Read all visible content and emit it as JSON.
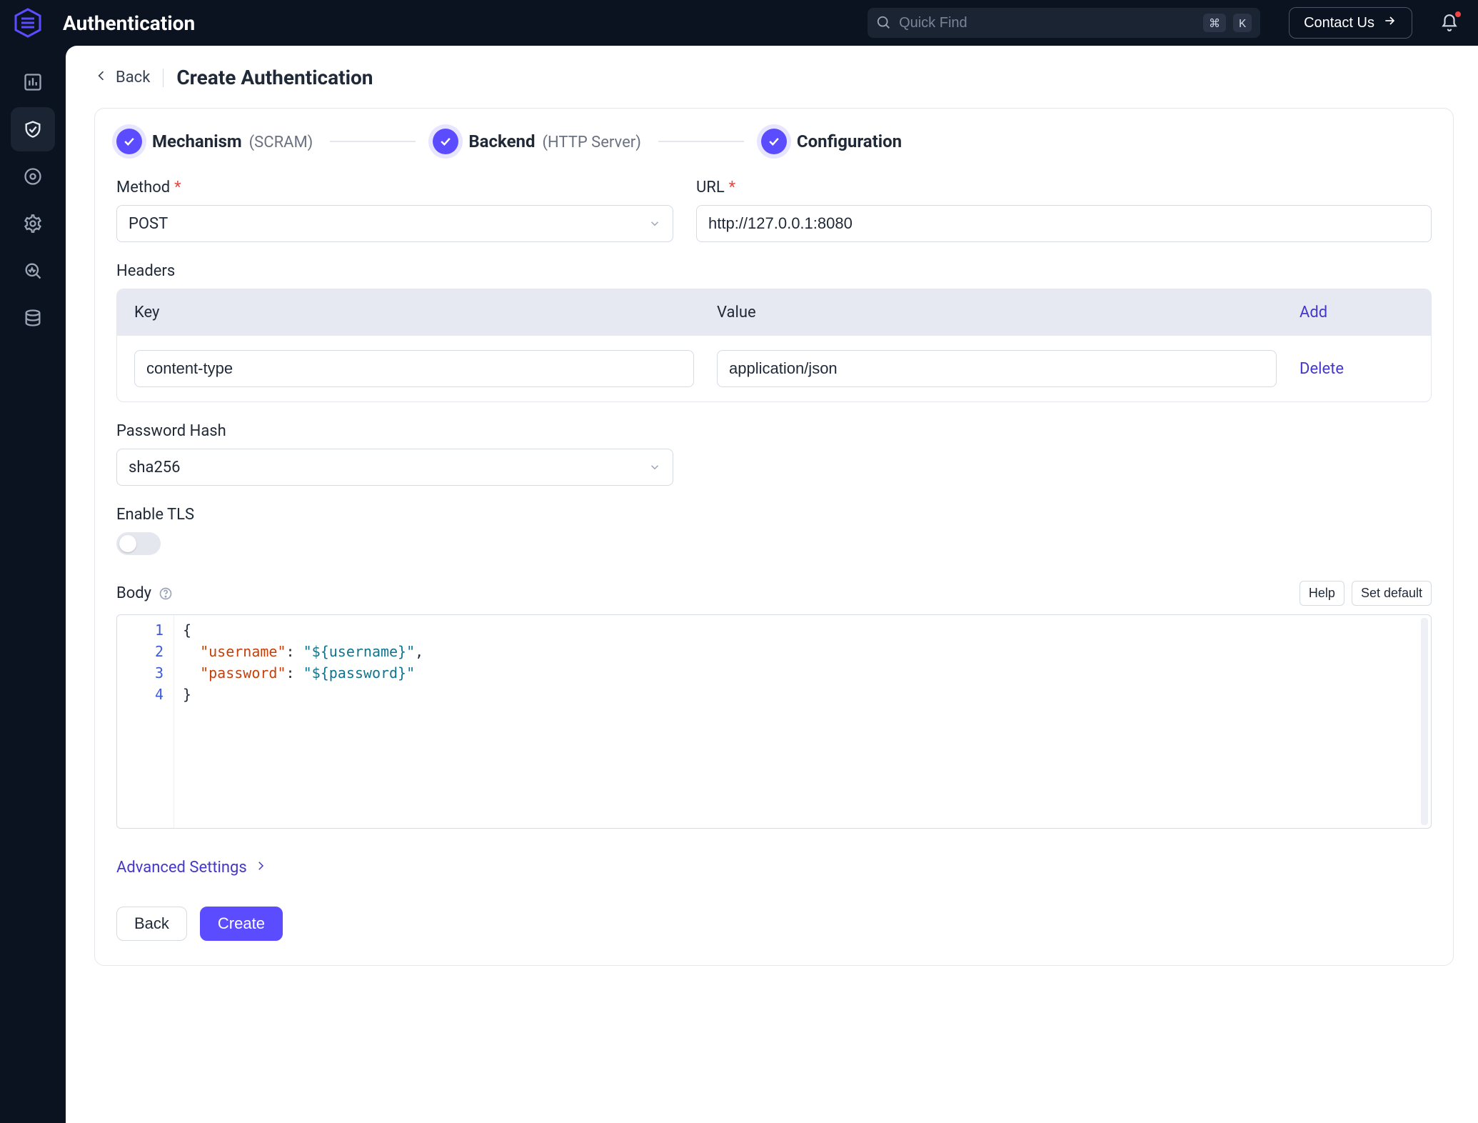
{
  "header": {
    "title": "Authentication",
    "search_placeholder": "Quick Find",
    "kbd_cmd": "⌘",
    "kbd_k": "K",
    "contact_label": "Contact Us"
  },
  "breadcrumb": {
    "back_label": "Back",
    "page_title": "Create Authentication"
  },
  "stepper": {
    "step1_label": "Mechanism",
    "step1_sub": "(SCRAM)",
    "step2_label": "Backend",
    "step2_sub": "(HTTP Server)",
    "step3_label": "Configuration"
  },
  "form": {
    "method_label": "Method",
    "method_value": "POST",
    "url_label": "URL",
    "url_value": "http://127.0.0.1:8080",
    "headers_label": "Headers",
    "headers": {
      "col_key": "Key",
      "col_value": "Value",
      "add_label": "Add",
      "rows": [
        {
          "key": "content-type",
          "value": "application/json"
        }
      ],
      "delete_label": "Delete"
    },
    "hash_label": "Password Hash",
    "hash_value": "sha256",
    "tls_label": "Enable TLS",
    "tls_on": false,
    "body_label": "Body",
    "help_label": "Help",
    "set_default_label": "Set default",
    "body_lines": {
      "l1": "{",
      "l2_key": "\"username\"",
      "l2_val": "\"${username}\"",
      "l2_comma": ",",
      "l3_key": "\"password\"",
      "l3_val": "\"${password}\"",
      "l4": "}"
    },
    "advanced_label": "Advanced Settings"
  },
  "footer": {
    "back_label": "Back",
    "create_label": "Create"
  }
}
